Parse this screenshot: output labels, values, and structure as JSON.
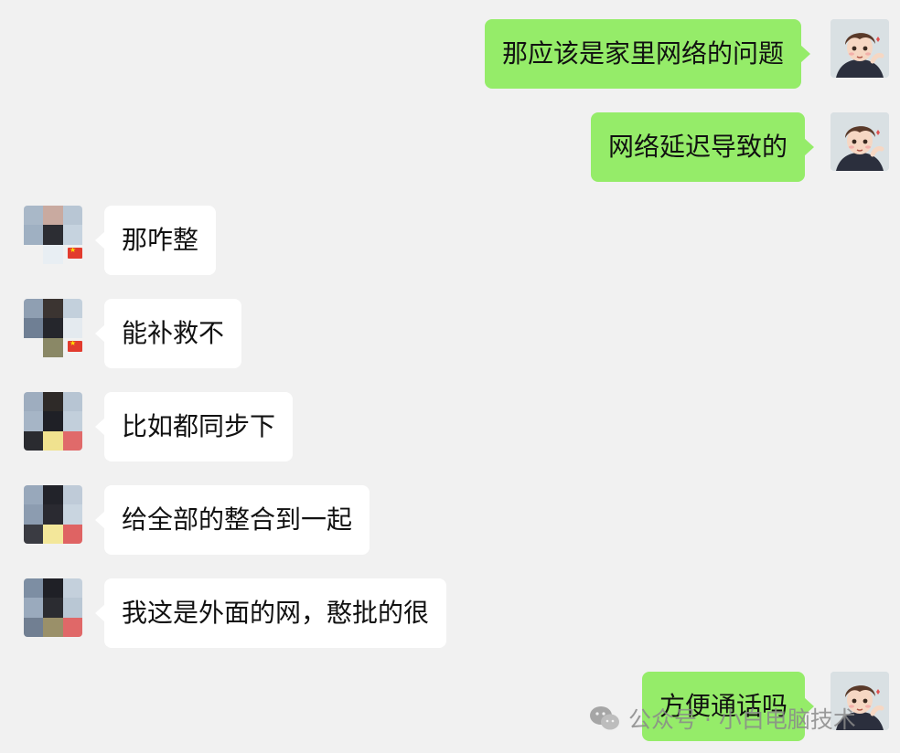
{
  "chat": {
    "messages": [
      {
        "id": "m1",
        "from": "self",
        "text": "那应该是家里网络的问题"
      },
      {
        "id": "m2",
        "from": "self",
        "text": "网络延迟导致的"
      },
      {
        "id": "m3",
        "from": "other",
        "text": "那咋整"
      },
      {
        "id": "m4",
        "from": "other",
        "text": "能补救不"
      },
      {
        "id": "m5",
        "from": "other",
        "text": "比如都同步下"
      },
      {
        "id": "m6",
        "from": "other",
        "text": "给全部的整合到一起"
      },
      {
        "id": "m7",
        "from": "other",
        "text": "我这是外面的网，憨批的很"
      },
      {
        "id": "m8",
        "from": "self",
        "text": "方便通话吗"
      }
    ]
  },
  "watermark": {
    "text": "公众号 · 小白电脑技术",
    "icon": "wechat-icon"
  },
  "colors": {
    "background": "#f1f1f1",
    "self_bubble": "#95ec69",
    "other_bubble": "#ffffff",
    "text": "#111111",
    "watermark": "#8a8a8a"
  },
  "avatars": {
    "self": "cartoon-boy-avatar",
    "other": "pixelated-avatar"
  }
}
